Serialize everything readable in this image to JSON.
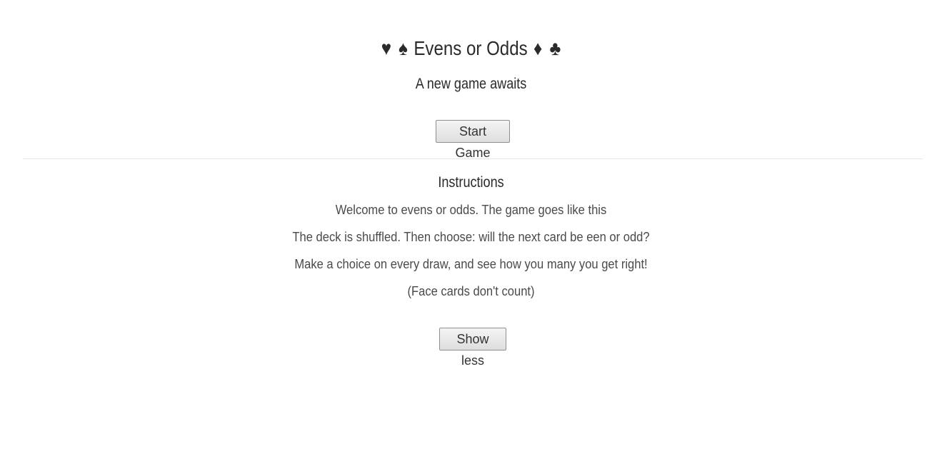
{
  "header": {
    "suits_left": [
      "♥",
      "♠"
    ],
    "title": "Evens or Odds",
    "suits_right": [
      "♦",
      "♣"
    ],
    "subtitle": "A new game awaits"
  },
  "actions": {
    "start_label": "Start Game"
  },
  "instructions": {
    "heading": "Instructions",
    "lines": [
      "Welcome to evens or odds. The game goes like this",
      "The deck is shuffled. Then choose: will the next card be een or odd?",
      "Make a choice on every draw, and see how you many you get right!",
      "(Face cards don't count)"
    ],
    "toggle_label": "Show less"
  }
}
